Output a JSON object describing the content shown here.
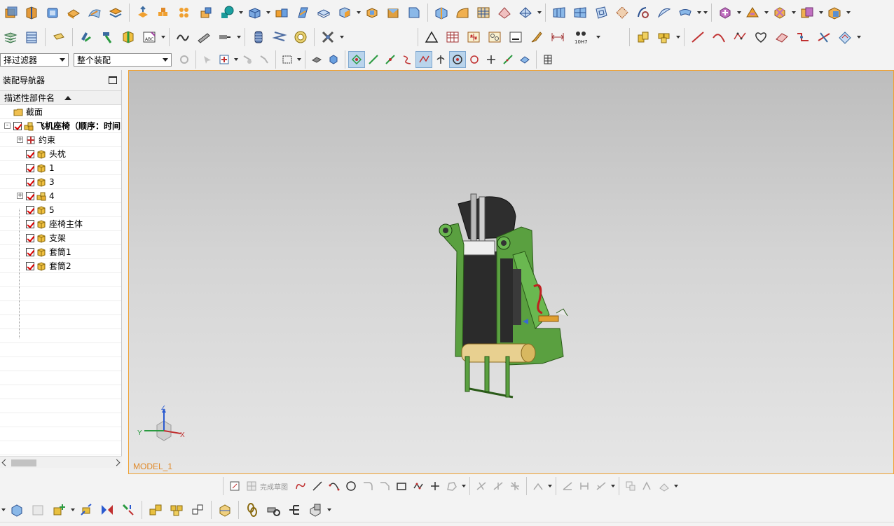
{
  "toolbar_row1_icons": [
    "box-icon",
    "split-body-icon",
    "cylinder-icon",
    "pad-icon",
    "surface-icon",
    "layer-icon",
    "extrude-icon",
    "pattern-icon",
    "array-icon",
    "combine-icon",
    "sphere-feature-icon",
    "block-icon",
    "sweep-icon",
    "offset-face-icon",
    "shell-icon",
    "cube-icon",
    "unite-icon",
    "cut-icon",
    "chamfer-icon",
    "draft-icon",
    "blend-icon",
    "mesh-surface-icon",
    "fill-surface-icon",
    "through-curves-icon",
    "trim-sheet-icon",
    "sew-icon",
    "section-body-icon",
    "extend-icon",
    "wrap-icon",
    "move-face-icon",
    "delete-face-icon",
    "replace-face-icon",
    "offset-region-icon",
    "transform-icon"
  ],
  "toolbar_row2_icons": [
    "layer-settings-icon",
    "stack-icon",
    "label-icon",
    "assembly-constraint-icon",
    "hammer-icon",
    "component-icon",
    "abc-text-icon",
    "wave-curve-icon",
    "rocket-icon",
    "insert-bolt-icon",
    "cylinder-spring-icon",
    "spring-icon",
    "bearing-icon",
    "cross-tool-icon",
    "triangle-sketch-icon",
    "table-grid-icon",
    "points-grid-icon",
    "pattern-pins-icon",
    "drawing-sheet-icon",
    "brush-icon",
    "dimension-icon",
    "tolerance-fit-icon",
    "add-component-icon",
    "add-components-icon",
    "line-curve-icon",
    "arc-curve-icon",
    "spline-curve-icon",
    "heart-curve-icon",
    "ruled-surface-icon",
    "bridge-curve-icon",
    "trim-curve-icon",
    "offset-curve-icon"
  ],
  "tolerance_text": "10H7",
  "selection_filter": {
    "value": "择过滤器"
  },
  "assembly_scope": {
    "value": "整个装配"
  },
  "navigator": {
    "title": "装配导航器",
    "column_header": "描述性部件名",
    "rows": [
      {
        "label": "截面",
        "indent": 1,
        "expander": "",
        "checked": false,
        "icon": "folder-icon"
      },
      {
        "label": "飞机座椅（顺序：时间",
        "indent": 1,
        "expander": "-",
        "checked": true,
        "icon": "assembly-icon",
        "bold": true
      },
      {
        "label": "约束",
        "indent": 2,
        "expander": "+",
        "checked": false,
        "icon": "constraint-icon"
      },
      {
        "label": "头枕",
        "indent": 2,
        "expander": "",
        "checked": true,
        "icon": "part-icon"
      },
      {
        "label": "1",
        "indent": 2,
        "expander": "",
        "checked": true,
        "icon": "part-icon"
      },
      {
        "label": "3",
        "indent": 2,
        "expander": "",
        "checked": true,
        "icon": "part-icon"
      },
      {
        "label": "4",
        "indent": 2,
        "expander": "+",
        "checked": true,
        "icon": "assembly-icon"
      },
      {
        "label": "5",
        "indent": 2,
        "expander": "",
        "checked": true,
        "icon": "part-icon"
      },
      {
        "label": "座椅主体",
        "indent": 2,
        "expander": "",
        "checked": true,
        "icon": "part-icon"
      },
      {
        "label": "支架",
        "indent": 2,
        "expander": "",
        "checked": true,
        "icon": "part-icon"
      },
      {
        "label": "套筒1",
        "indent": 2,
        "expander": "",
        "checked": true,
        "icon": "part-icon"
      },
      {
        "label": "套筒2",
        "indent": 2,
        "expander": "",
        "checked": true,
        "icon": "part-icon"
      }
    ]
  },
  "viewport": {
    "model_name": "MODEL_1",
    "triad": {
      "x": "X",
      "y": "Y",
      "z": "Z"
    }
  },
  "sketch_toolbar": {
    "finish_sketch_label": "完成草图"
  },
  "colors": {
    "accent_orange": "#f0a030",
    "model_green": "#5aa040",
    "model_dark": "#2b2b2b",
    "check_red": "#d00000",
    "part_yellow": "#e8c040"
  }
}
